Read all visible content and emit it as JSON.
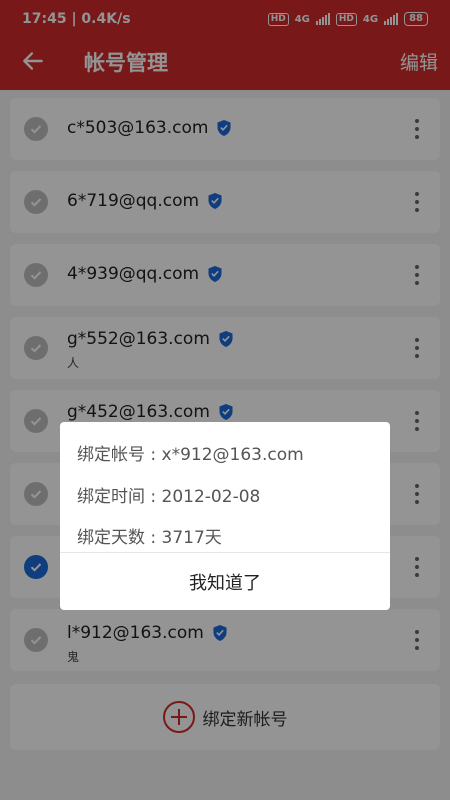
{
  "status": {
    "time": "17:45 | 0.4K/s",
    "hd1": "HD",
    "net1": "4G",
    "hd2": "HD",
    "net2": "4G",
    "battery": "88"
  },
  "appbar": {
    "title": "帐号管理",
    "edit": "编辑",
    "accent_color": "#d12a2a"
  },
  "accounts": [
    {
      "email": "c*503@163.com",
      "sub": "",
      "selected": false
    },
    {
      "email": "6*719@qq.com",
      "sub": "",
      "selected": false
    },
    {
      "email": "4*939@qq.com",
      "sub": "",
      "selected": false
    },
    {
      "email": "g*552@163.com",
      "sub": "人",
      "selected": false
    },
    {
      "email": "g*452@163.com",
      "sub": "",
      "selected": false
    },
    {
      "email": "",
      "sub": "",
      "selected": false
    },
    {
      "email": "",
      "sub": "",
      "selected": true
    },
    {
      "email": "l*912@163.com",
      "sub": "鬼",
      "selected": false
    }
  ],
  "add_account": {
    "label": "绑定新帐号"
  },
  "dialog": {
    "account": "绑定帐号 : x*912@163.com",
    "time": "绑定时间 : 2012-02-08",
    "days": "绑定天数 : 3717天",
    "button": "我知道了"
  },
  "icons": {
    "back": "arrow-left-icon",
    "verified": "shield-check-icon",
    "more": "more-vertical-icon",
    "check": "check-circle-icon",
    "add": "plus-circle-icon"
  },
  "colors": {
    "selected_check": "#1a6ad8",
    "unselected_check": "#bdbdbd",
    "verified_shield": "#1a6ad8"
  }
}
